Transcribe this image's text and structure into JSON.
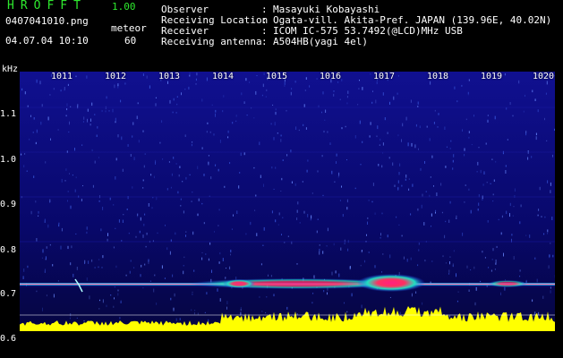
{
  "app": {
    "title": "HROFFT",
    "version": "1.00"
  },
  "meta": {
    "filename": "0407041010.png",
    "mode": "meteor",
    "timestamp": "04.07.04 10:10",
    "count": "60"
  },
  "info": [
    {
      "key": "Observer",
      "value": "Masayuki Kobayashi"
    },
    {
      "key": "Receiving Location",
      "value": "Ogata-vill. Akita-Pref. JAPAN (139.96E, 40.02N)"
    },
    {
      "key": "Receiver",
      "value": "ICOM IC-575 53.7492(@LCD)MHz USB"
    },
    {
      "key": "Receiving antenna",
      "value": "A504HB(yagi 4el)"
    }
  ],
  "axis": {
    "y_unit": "kHz",
    "y_ticks": [
      "1.1",
      "1.0",
      "0.9",
      "0.8",
      "0.7",
      "0.6"
    ],
    "x_ticks": [
      "1011",
      "1012",
      "1013",
      "1014",
      "1015",
      "1016",
      "1017",
      "1018",
      "1019",
      "1020"
    ]
  },
  "colors": {
    "title": "#2ee82e",
    "background": "#000000",
    "spectrum_bg": "#0a0a6a",
    "signal": "#ffff00",
    "trace": "#ff2a6a"
  }
}
